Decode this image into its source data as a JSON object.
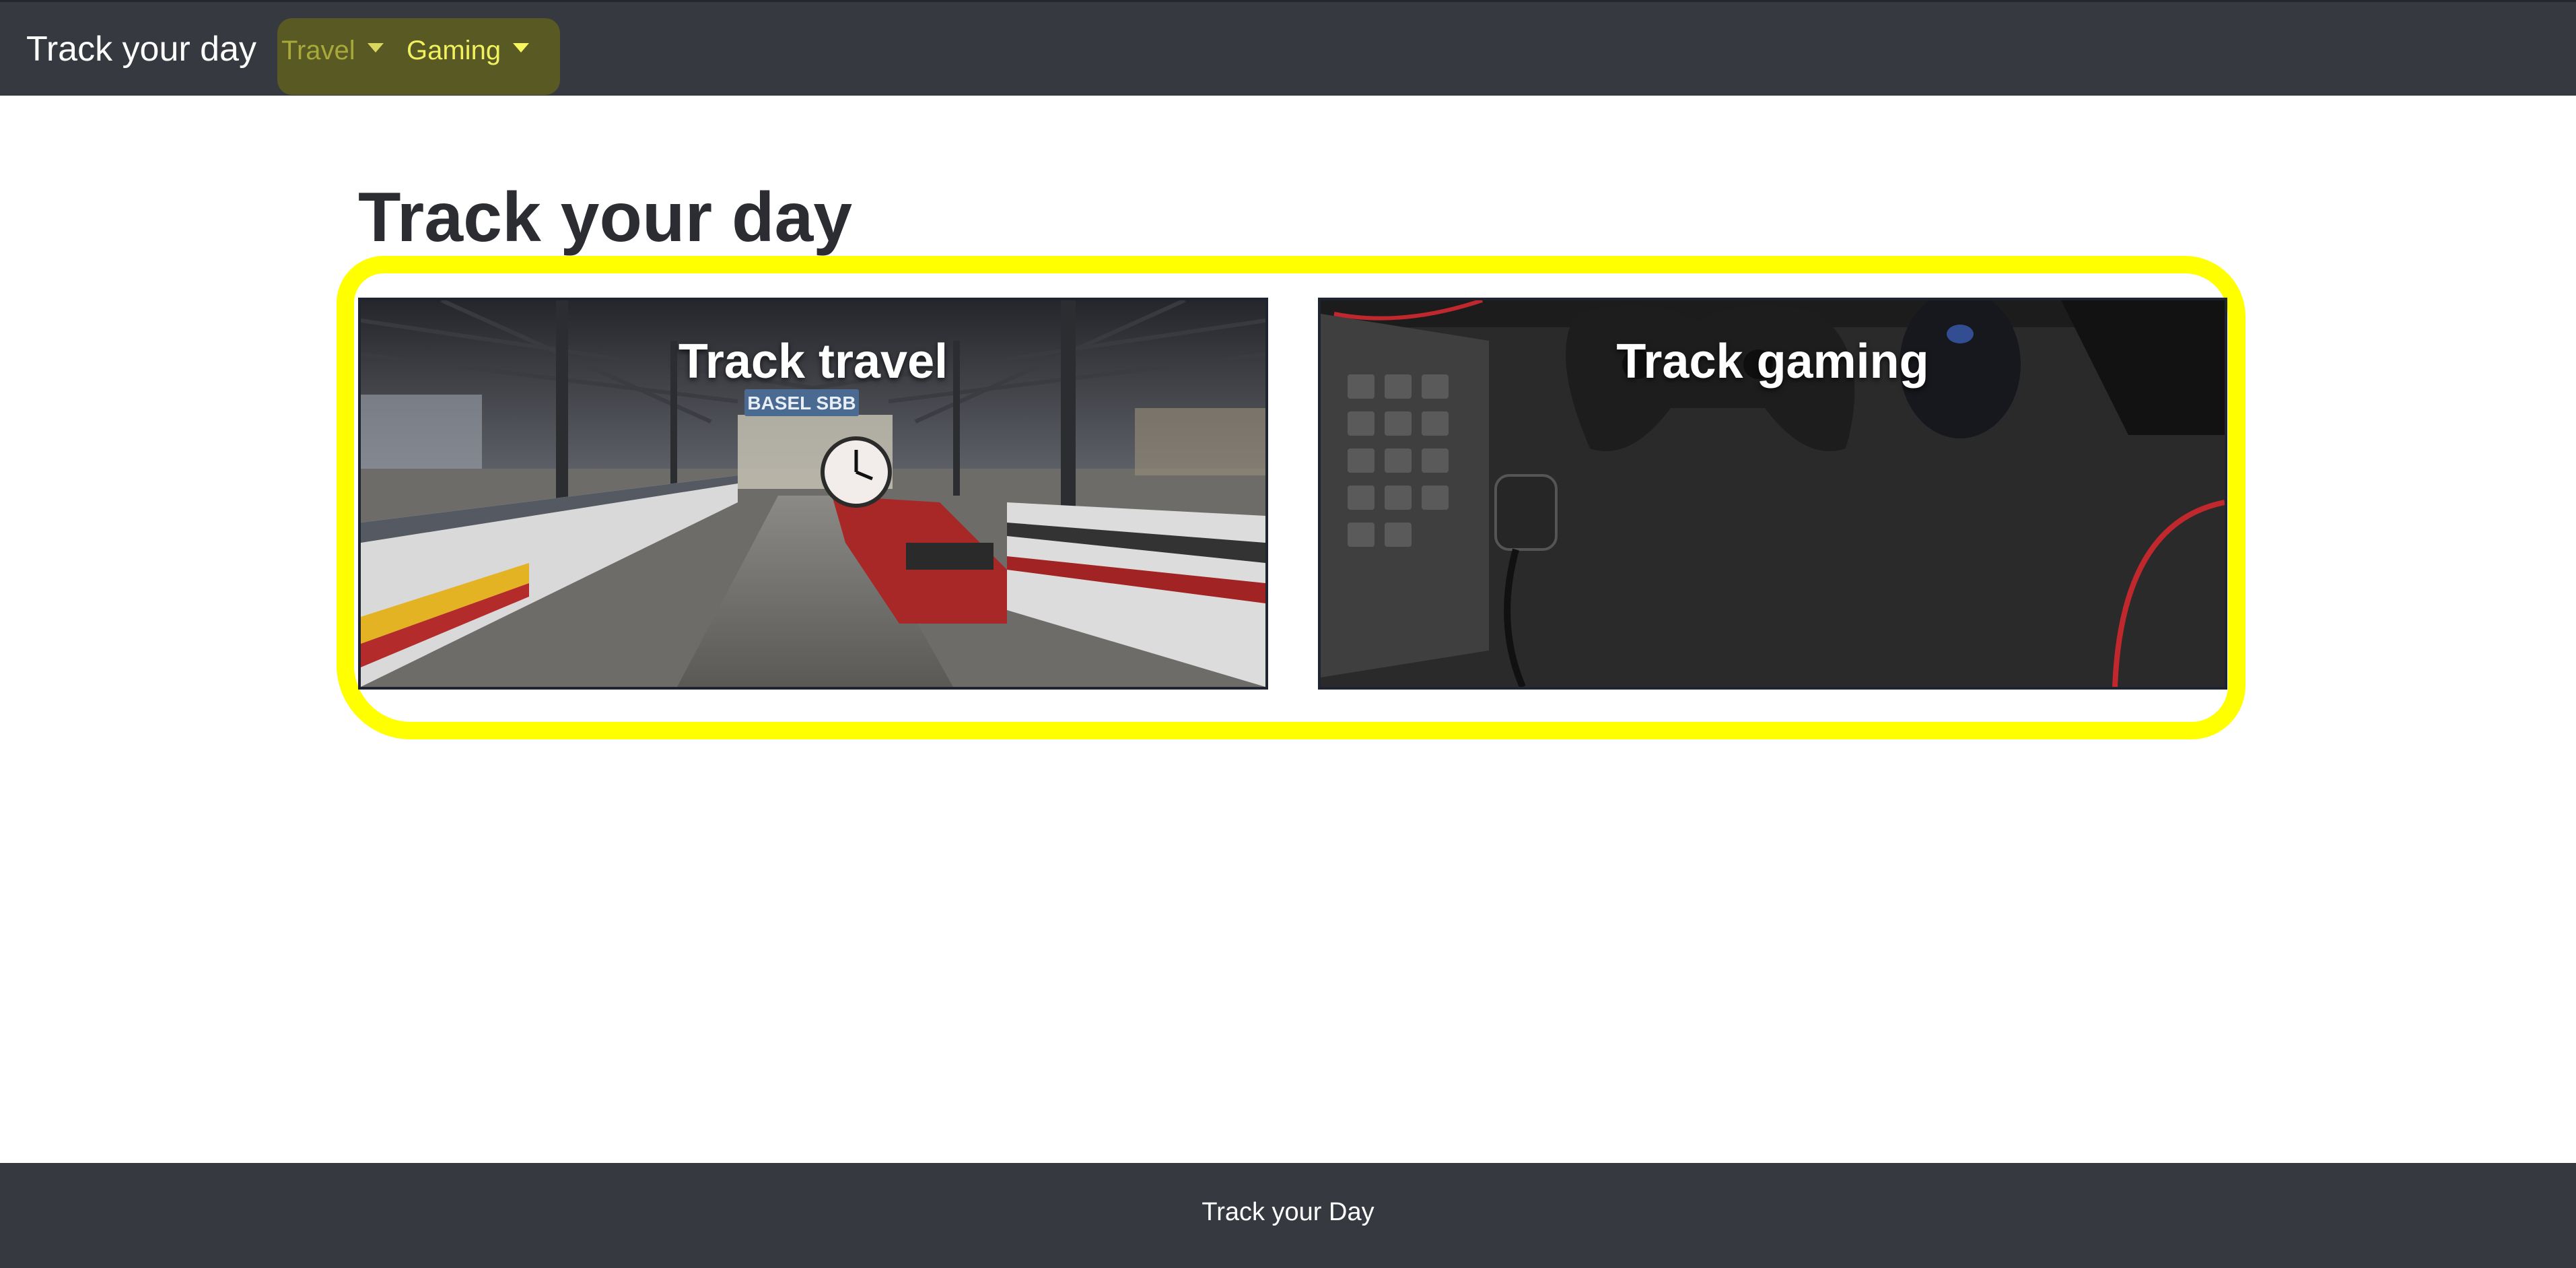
{
  "navbar": {
    "brand": "Track your day",
    "items": [
      {
        "label": "Travel"
      },
      {
        "label": "Gaming"
      }
    ]
  },
  "main": {
    "title": "Track your day",
    "cards": [
      {
        "title": "Track travel",
        "sign_text": "BASEL SBB"
      },
      {
        "title": "Track gaming"
      }
    ]
  },
  "footer": {
    "text": "Track your Day"
  },
  "colors": {
    "navbar_bg": "#363940",
    "highlight": "#ffff00",
    "page_bg": "#ffffff"
  }
}
